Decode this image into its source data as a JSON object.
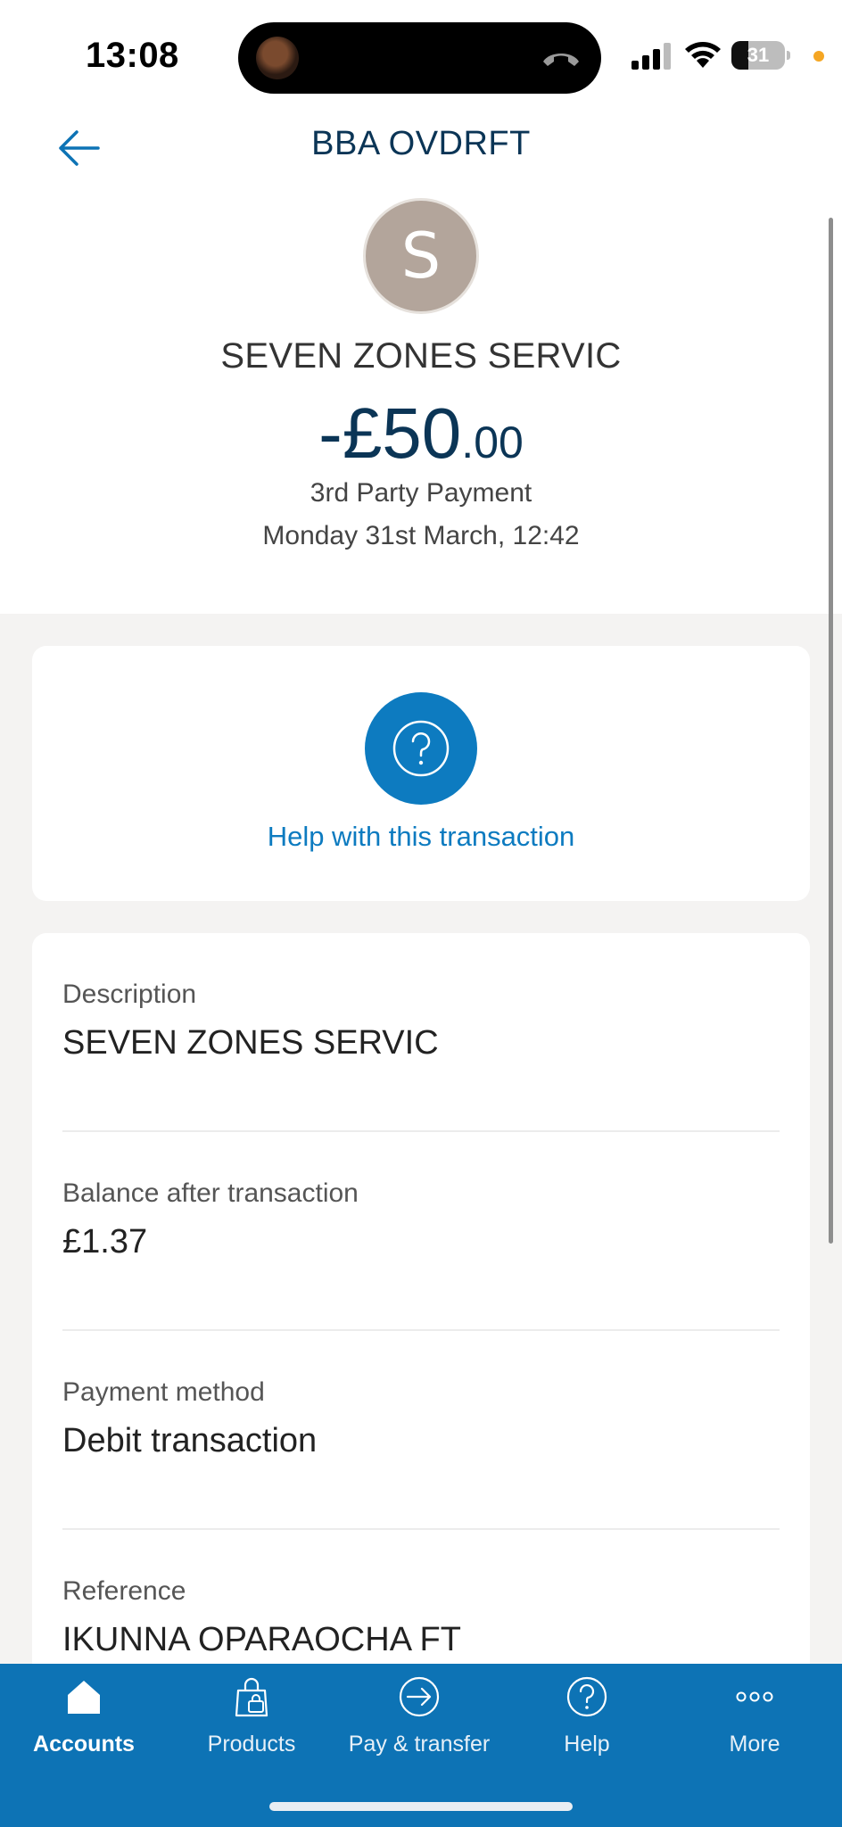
{
  "status_bar": {
    "time": "13:08",
    "battery": "31",
    "battery_level": 0.31
  },
  "header": {
    "title": "BBA OVDRFT",
    "avatar_letter": "S",
    "merchant": "SEVEN ZONES SERVIC",
    "amount_main": "-£50",
    "amount_pence": ".00",
    "transaction_type": "3rd Party Payment",
    "datetime": "Monday 31st March, 12:42"
  },
  "help": {
    "label": "Help with this transaction"
  },
  "details": [
    {
      "label": "Description",
      "value": "SEVEN ZONES SERVIC"
    },
    {
      "label": "Balance after transaction",
      "value": "£1.37"
    },
    {
      "label": "Payment method",
      "value": "Debit transaction"
    },
    {
      "label": "Reference",
      "value": "IKUNNA OPARAOCHA FT"
    }
  ],
  "tabs": [
    {
      "label": "Accounts",
      "icon": "home-icon",
      "active": true
    },
    {
      "label": "Products",
      "icon": "shopping-bag-icon",
      "active": false
    },
    {
      "label": "Pay & transfer",
      "icon": "arrow-circle-icon",
      "active": false
    },
    {
      "label": "Help",
      "icon": "question-circle-icon",
      "active": false
    },
    {
      "label": "More",
      "icon": "more-dots-icon",
      "active": false
    }
  ],
  "colors": {
    "brand_blue": "#0d73b5",
    "navy_text": "#0b3556",
    "avatar_bg": "#b3a59b"
  }
}
